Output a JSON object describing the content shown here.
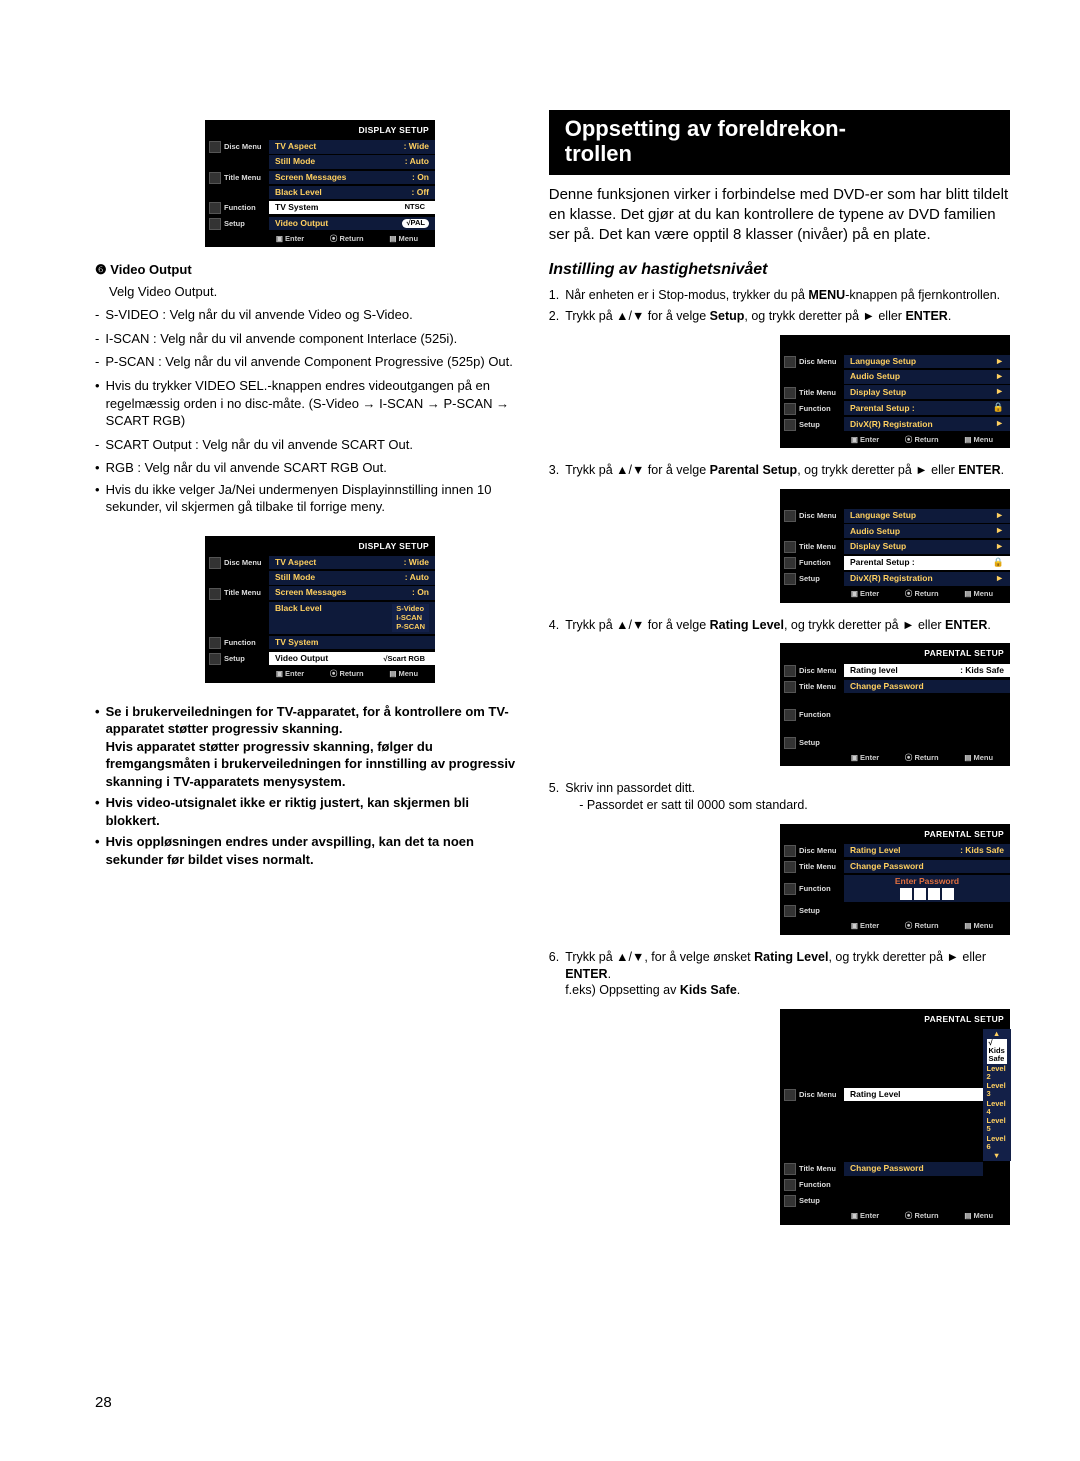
{
  "page_number": "28",
  "left": {
    "video_output_heading_num": "❻",
    "video_output_heading": "Video Output",
    "video_output_sub": "Velg Video Output.",
    "items": [
      {
        "t": "S-VIDEO : Velg når du vil anvende Video og S-Video."
      },
      {
        "t": "I-SCAN : Velg når du vil anvende component Interlace (525i)."
      },
      {
        "t": "P-SCAN : Velg når du vil anvende Component Progressive (525p) Out."
      },
      {
        "t": "Hvis du trykker VIDEO SEL.-knappen endres videoutgangen på en regelmæssig orden i no disc-måte. (S-Video → I-SCAN → P-SCAN → SCART RGB)",
        "sub": true
      },
      {
        "t": "SCART Output : Velg når du vil anvende SCART Out."
      },
      {
        "t": "RGB : Velg når du vil anvende SCART RGB Out.",
        "sub": true
      },
      {
        "t": "Hvis du ikke velger Ja/Nei undermenyen Displayinnstilling innen 10 sekunder, vil skjermen gå tilbake til forrige meny.",
        "dot": true
      }
    ],
    "notes": [
      "Se i brukerveiledningen for TV-apparatet, for å kontrollere om TV-apparatet støtter progressiv skanning.\nHvis apparatet støtter progressiv skanning, følger du fremgangsmåten i brukerveiledningen for innstilling av progressiv skanning i TV-apparatets menysystem.",
      "Hvis video-utsignalet ikke er riktig justert, kan skjermen bli blokkert.",
      "Hvis oppløsningen endres under avspilling, kan det ta noen sekunder før bildet vises normalt."
    ],
    "osd1": {
      "title": "DISPLAY SETUP",
      "side": [
        "Disc Menu",
        "Title Menu",
        "Function",
        "Setup"
      ],
      "rows": [
        {
          "lab": "TV Aspect",
          "val": ": Wide"
        },
        {
          "lab": "Still Mode",
          "val": ": Auto"
        },
        {
          "lab": "Screen Messages",
          "val": ": On"
        },
        {
          "lab": "Black Level",
          "val": ": Off"
        },
        {
          "lab": "TV System",
          "pill": "NTSC",
          "hl": true
        },
        {
          "lab": "Video Output",
          "pill": "√PAL",
          "pill_hl": true
        }
      ],
      "footer": [
        "▣ Enter",
        "⦿ Return",
        "▤ Menu"
      ]
    },
    "osd2": {
      "title": "DISPLAY SETUP",
      "side": [
        "Disc Menu",
        "Title Menu",
        "Function",
        "Setup"
      ],
      "rows": [
        {
          "lab": "TV Aspect",
          "val": ": Wide"
        },
        {
          "lab": "Still Mode",
          "val": ": Auto"
        },
        {
          "lab": "Screen Messages",
          "val": ": On"
        },
        {
          "lab": "Black Level",
          "stack": [
            "S-Video",
            "I-SCAN",
            "P-SCAN"
          ]
        },
        {
          "lab": "TV System"
        },
        {
          "lab": "Video Output",
          "pill": "√Scart RGB",
          "hl": true
        }
      ],
      "footer": [
        "▣ Enter",
        "⦿ Return",
        "▤ Menu"
      ]
    }
  },
  "right": {
    "h2a": "Oppsetting av foreldrekon-",
    "h2b": "trollen",
    "intro": "Denne funksjonen virker i forbindelse med DVD-er som har blitt tildelt en klasse. Det gjør at du kan kontrollere de typene av DVD familien ser på. Det kan være opptil 8 klasser (nivåer) på en plate.",
    "sub": "Instilling av hastighetsnivået",
    "steps": [
      {
        "n": "1.",
        "pre": "Når enheten er i Stop-modus, trykker du på ",
        "b": "MENU",
        "post": "-knappen på fjernkontrollen."
      },
      {
        "n": "2.",
        "pre": "Trykk på ▲/▼ for å velge ",
        "b": "Setup",
        "post": ", og trykk deretter på ► eller ",
        "b2": "ENTER",
        "post2": "."
      },
      {
        "n": "3.",
        "pre": "Trykk på ▲/▼ for å velge ",
        "b": "Parental Setup",
        "post": ", og trykk deretter på ► eller ",
        "b2": "ENTER",
        "post2": "."
      },
      {
        "n": "4.",
        "pre": "Trykk på ▲/▼ for å velge ",
        "b": "Rating Level",
        "post": ", og trykk deretter på ► eller ",
        "b2": "ENTER",
        "post2": "."
      },
      {
        "n": "5.",
        "pre": "Skriv inn passordet ditt.",
        "post": "",
        "extra": "- Passordet er satt til 0000 som standard."
      },
      {
        "n": "6.",
        "pre": "Trykk på ▲/▼, for å velge ønsket ",
        "b": "Rating Level",
        "post": ", og trykk deretter på ► eller ",
        "b2": "ENTER",
        "post2": ".",
        "extra2": "f.eks) Oppsetting av ",
        "extra2b": "Kids Safe",
        "extra2post": "."
      }
    ],
    "osd_setup": {
      "side": [
        "Disc Menu",
        "Title Menu",
        "Function",
        "Setup"
      ],
      "rows": [
        {
          "lab": "Language Setup",
          "arrow": true
        },
        {
          "lab": "Audio Setup",
          "arrow": true
        },
        {
          "lab": "Display Setup",
          "arrow": true
        },
        {
          "lab": "Parental Setup :",
          "lock": true
        },
        {
          "lab": "DivX(R) Registration",
          "arrow": true
        }
      ],
      "footer": [
        "▣ Enter",
        "⦿ Return",
        "▤ Menu"
      ]
    },
    "osd_setup_hl": {
      "side": [
        "Disc Menu",
        "Title Menu",
        "Function",
        "Setup"
      ],
      "rows": [
        {
          "lab": "Language Setup",
          "arrow": true
        },
        {
          "lab": "Audio Setup",
          "arrow": true
        },
        {
          "lab": "Display Setup",
          "arrow": true
        },
        {
          "lab": "Parental Setup :",
          "lock": true,
          "hl": true
        },
        {
          "lab": "DivX(R) Registration",
          "arrow": true
        }
      ],
      "footer": [
        "▣ Enter",
        "⦿ Return",
        "▤ Menu"
      ]
    },
    "osd_parental": {
      "title": "PARENTAL SETUP",
      "side": [
        "Disc Menu",
        "Title Menu",
        "Function",
        "Setup"
      ],
      "rows": [
        {
          "lab": "Rating level",
          "val": ": Kids Safe",
          "hl": true
        },
        {
          "lab": "Change Password"
        }
      ],
      "footer": [
        "▣ Enter",
        "⦿ Return",
        "▤ Menu"
      ]
    },
    "osd_password": {
      "title": "PARENTAL SETUP",
      "side": [
        "Disc Menu",
        "Title Menu",
        "Function",
        "Setup"
      ],
      "rows": [
        {
          "lab": "Rating Level",
          "val": ": Kids Safe"
        },
        {
          "lab": "Change Password"
        }
      ],
      "pw": "Enter Password",
      "footer": [
        "▣ Enter",
        "⦿ Return",
        "▤ Menu"
      ]
    },
    "osd_levels": {
      "title": "PARENTAL SETUP",
      "side": [
        "Disc Menu",
        "Title Menu",
        "Function",
        "Setup"
      ],
      "rows": [
        {
          "lab": "Rating Level",
          "hl": true
        },
        {
          "lab": "Change Password"
        }
      ],
      "levels": [
        "√ Kids Safe",
        "Level 2",
        "Level 3",
        "Level 4",
        "Level 5",
        "Level 6"
      ],
      "footer": [
        "▣ Enter",
        "⦿ Return",
        "▤ Menu"
      ]
    }
  }
}
